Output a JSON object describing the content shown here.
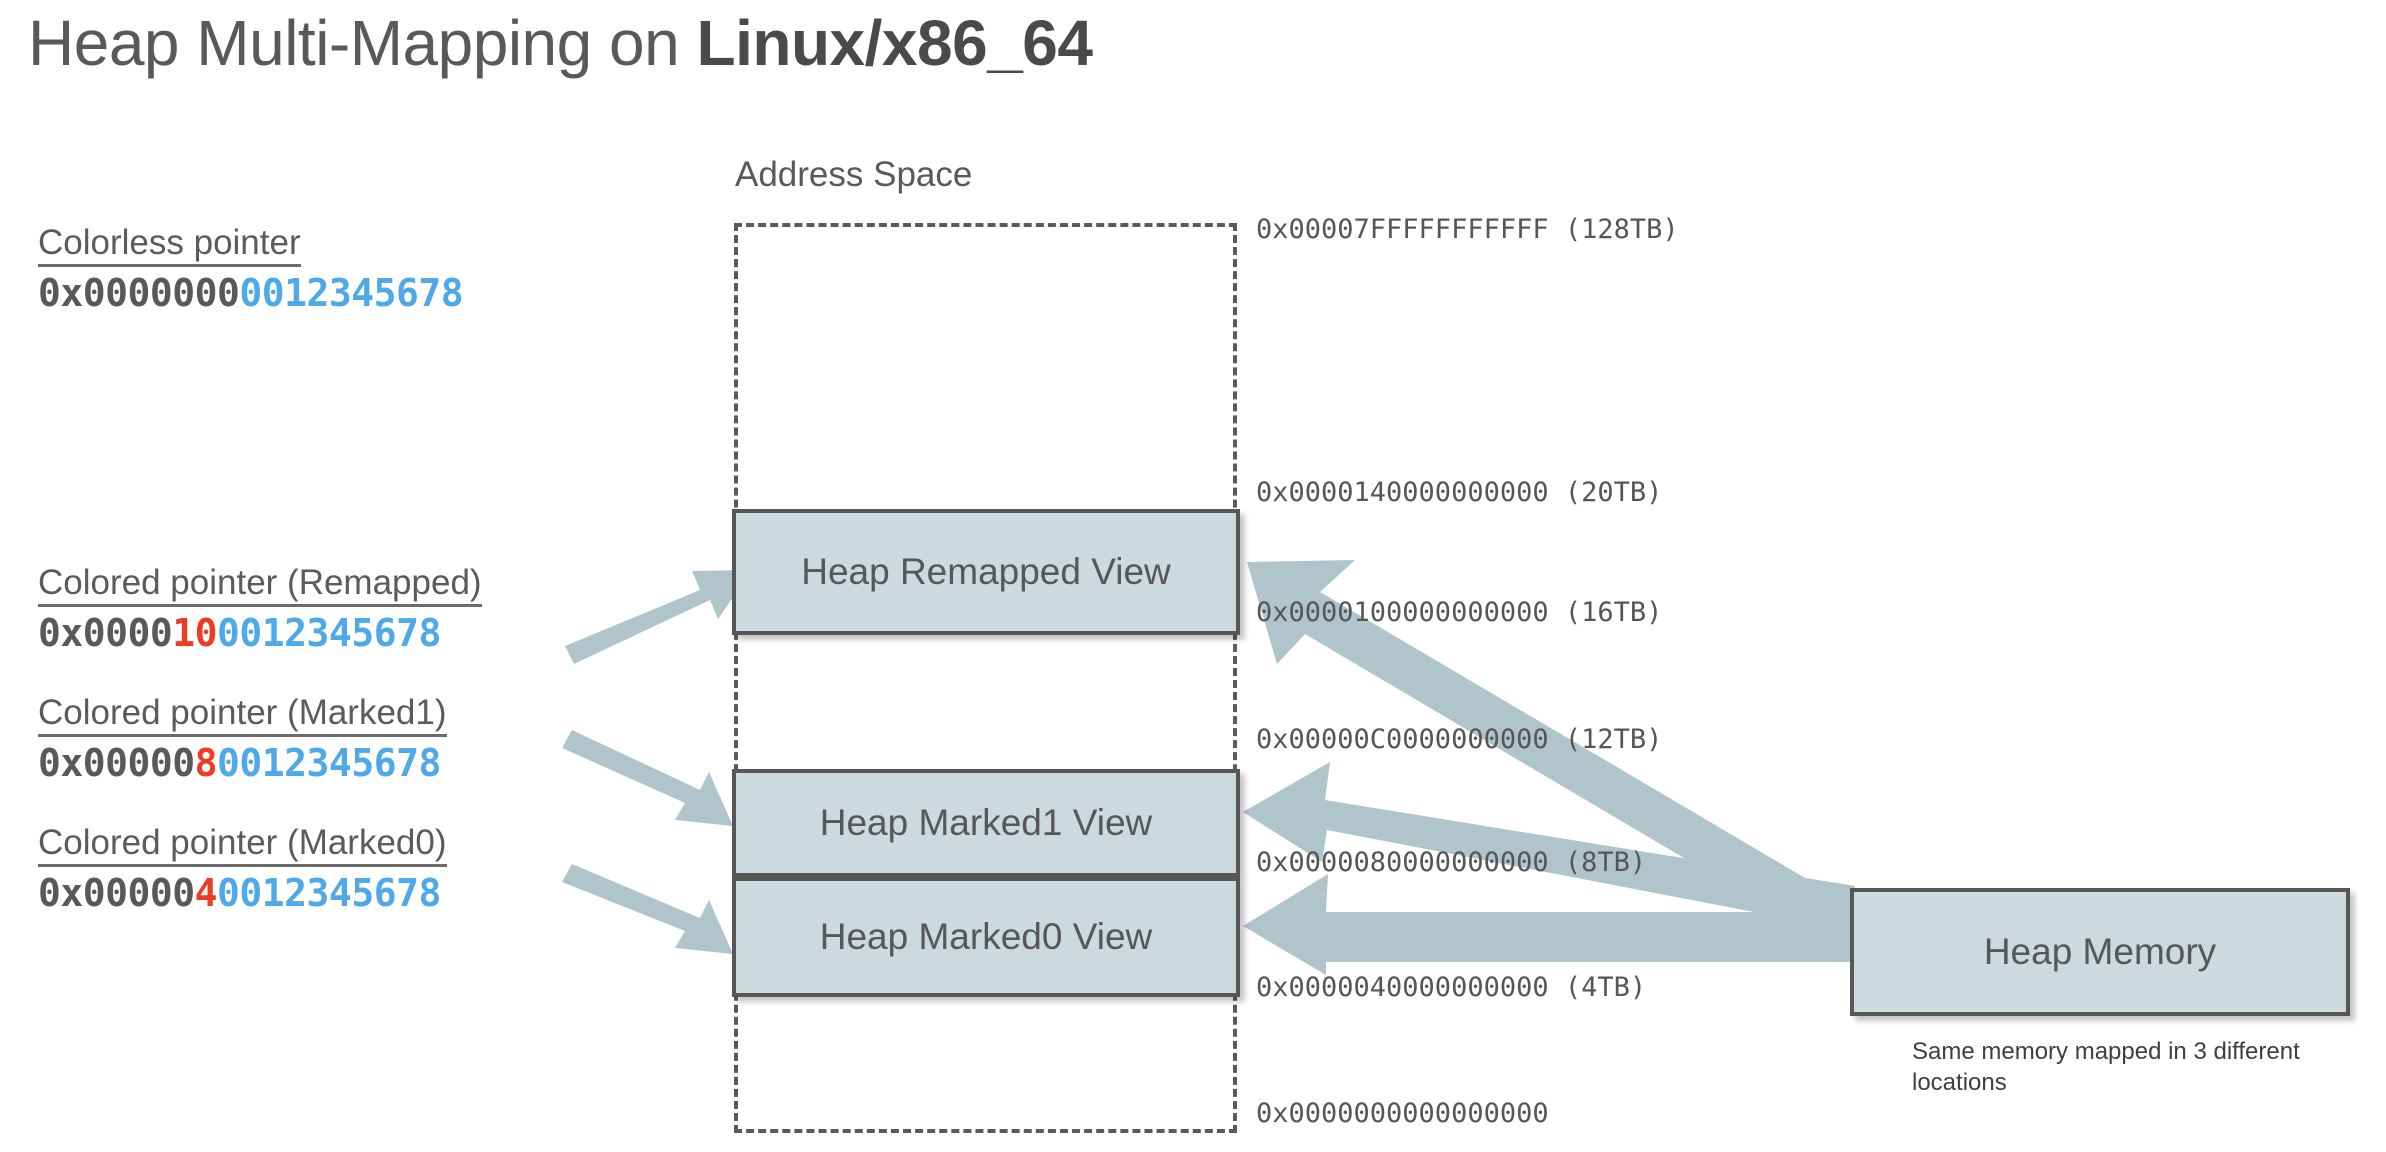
{
  "title": {
    "plain": "Heap Multi-Mapping on ",
    "bold": "Linux/x86_64"
  },
  "address_space": {
    "label": "Address Space",
    "ticks": [
      {
        "addr": "0x00007FFFFFFFFFFF",
        "size": "(128TB)"
      },
      {
        "addr": "0x0000140000000000",
        "size": "(20TB)"
      },
      {
        "addr": "0x0000100000000000",
        "size": "(16TB)"
      },
      {
        "addr": "0x00000C0000000000",
        "size": "(12TB)"
      },
      {
        "addr": "0x0000080000000000",
        "size": "(8TB)"
      },
      {
        "addr": "0x0000040000000000",
        "size": "(4TB)"
      },
      {
        "addr": "0x0000000000000000",
        "size": ""
      }
    ]
  },
  "views": {
    "remapped": "Heap Remapped View",
    "marked1": "Heap Marked1 View",
    "marked0": "Heap Marked0 View"
  },
  "heap_memory": {
    "label": "Heap Memory",
    "caption": "Same memory mapped in 3 different locations"
  },
  "pointers": [
    {
      "caption": "Colorless pointer",
      "prefix": "0x0000000",
      "color_nibble": "",
      "suffix": "0012345678"
    },
    {
      "caption": "Colored pointer (Remapped)",
      "prefix": "0x0000",
      "color_nibble": "10",
      "suffix": "0012345678"
    },
    {
      "caption": "Colored pointer (Marked1)",
      "prefix": "0x00000",
      "color_nibble": "8",
      "suffix": "0012345678"
    },
    {
      "caption": "Colored pointer (Marked0)",
      "prefix": "0x00000",
      "color_nibble": "4",
      "suffix": "0012345678"
    }
  ],
  "colors": {
    "title_text": "#595959",
    "box_fill": "#ccd9dd",
    "box_border": "#575757",
    "arrow": "#b0c4cc",
    "pointer_base": "#595959",
    "pointer_color_bits": "#ef3b24",
    "pointer_offset": "#4fa9e8"
  }
}
